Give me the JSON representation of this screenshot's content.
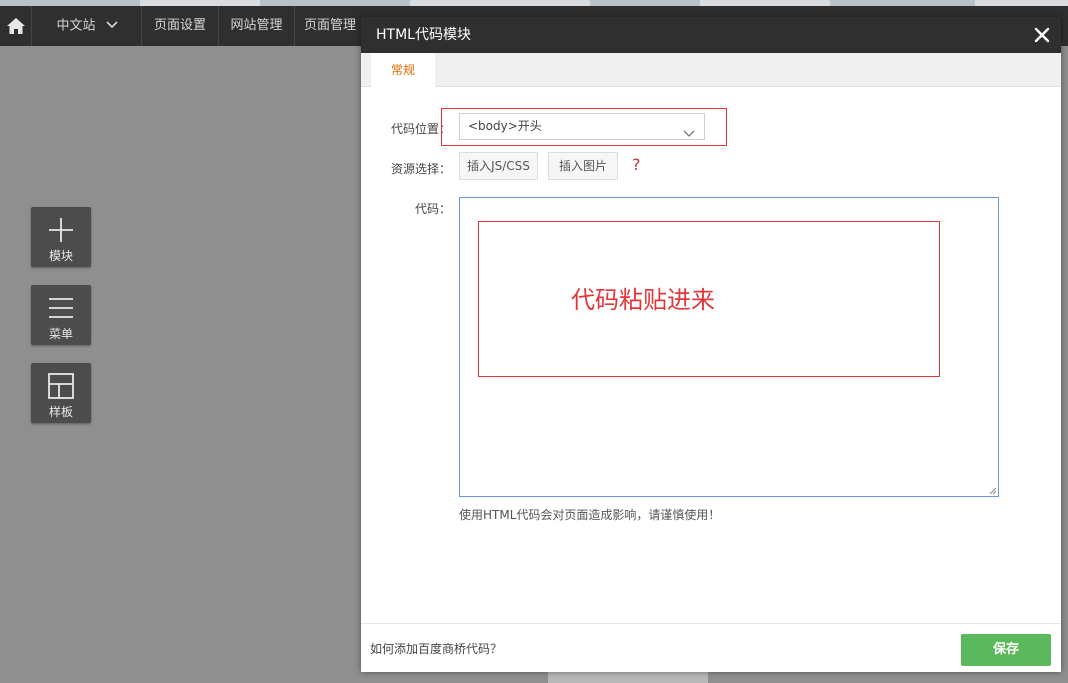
{
  "topbar": {
    "site_selector": "中文站",
    "nav": [
      "页面设置",
      "网站管理",
      "页面管理"
    ]
  },
  "sidebar_tools": [
    {
      "label": "模块",
      "icon": "plus-icon"
    },
    {
      "label": "菜单",
      "icon": "menu-icon"
    },
    {
      "label": "样板",
      "icon": "layout-icon"
    }
  ],
  "dialog": {
    "title": "HTML代码模块",
    "tabs": [
      {
        "label": "常规",
        "active": true
      }
    ],
    "form": {
      "position_label": "代码位置：",
      "position_value": "<body>开头",
      "resource_label": "资源选择：",
      "insert_js_css": "插入JS/CSS",
      "insert_image": "插入图片",
      "help": "?",
      "code_label": "代码：",
      "code_value": "",
      "paste_hint": "代码粘贴进来",
      "warning": "使用HTML代码会对页面造成影响，请谨慎使用！"
    },
    "footer": {
      "help_link": "如何添加百度商桥代码？",
      "save": "保存"
    }
  },
  "colors": {
    "accent_orange": "#e26a00",
    "highlight_red": "#e0383a",
    "save_green": "#5cb85c",
    "header_dark": "#2f2f2f"
  }
}
